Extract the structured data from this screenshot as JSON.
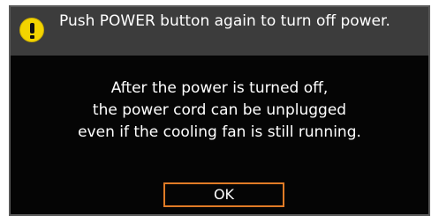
{
  "dialog": {
    "header_icon": "warning-exclamation-icon",
    "header_text": "Push POWER button again to turn off power.",
    "message_lines": [
      "After the power is turned off,",
      "the power cord can be unplugged",
      "even if the cooling fan is still running."
    ],
    "ok_label": "OK"
  },
  "colors": {
    "header_background": "#3c3c3c",
    "dialog_background": "#050505",
    "warning_icon": "#f3d400",
    "button_border": "#e07b26"
  }
}
